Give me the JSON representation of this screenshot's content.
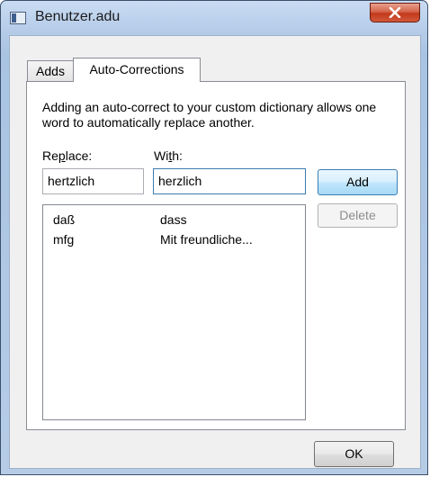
{
  "window": {
    "title": "Benutzer.adu",
    "close_icon": "close-icon"
  },
  "tabs": [
    {
      "label": "Adds"
    },
    {
      "label": "Auto-Corrections"
    }
  ],
  "panel": {
    "description": "Adding an auto-correct to your custom dictionary allows one word to automatically replace another.",
    "replace_label_pre": "Re",
    "replace_label_key": "p",
    "replace_label_post": "lace:",
    "with_label_pre": "Wi",
    "with_label_key": "t",
    "with_label_post": "h:",
    "replace_value": "hertzlich",
    "with_value": "herzlich",
    "add_label": "Add",
    "delete_label": "Delete",
    "entries": [
      {
        "replace": "daß",
        "with": "dass"
      },
      {
        "replace": "mfg",
        "with": "Mit freundliche..."
      }
    ]
  },
  "footer": {
    "ok_label": "OK"
  }
}
